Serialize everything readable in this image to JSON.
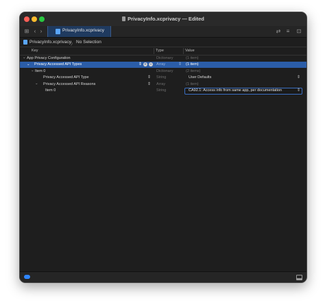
{
  "window": {
    "title": "PrivacyInfo.xcprivacy — Edited",
    "tab_label": "PrivacyInfo.xcprivacy"
  },
  "toolbar": {
    "grid_icon": "grid-icon",
    "back_icon": "chevron-left-icon",
    "forward_icon": "chevron-right-icon",
    "right_icons": [
      "swap-arrows-icon",
      "list-icon",
      "add-editor-icon"
    ]
  },
  "pathbar": {
    "file": "PrivacyInfo.xcprivacy",
    "separator": "〉",
    "selection": "No Selection"
  },
  "columns": {
    "key": "Key",
    "type": "Type",
    "value": "Value"
  },
  "rows": [
    {
      "key": "App Privacy Configuration",
      "type": "Dictionary",
      "value": "(1 item)"
    },
    {
      "key": "Privacy Accessed API Types",
      "type": "Array",
      "value": "(1 item)"
    },
    {
      "key": "Item 0",
      "type": "Dictionary",
      "value": "(2 items)"
    },
    {
      "key": "Privacy Accessed API Type",
      "type": "String",
      "value": "User Defaults"
    },
    {
      "key": "Privacy Accessed API Reasons",
      "type": "Array",
      "value": "(1 item)"
    },
    {
      "key": "Item 0",
      "type": "String",
      "value": "CA92.1: Access info from same app, per documentation"
    }
  ],
  "colors": {
    "accent": "#2b5da8",
    "background": "#1e1e1e"
  }
}
